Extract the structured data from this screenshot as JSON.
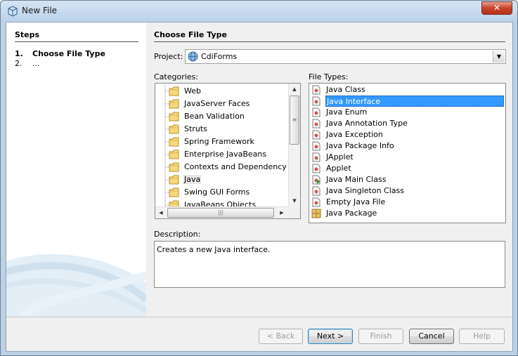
{
  "window": {
    "title": "New File",
    "close_glyph": "✕"
  },
  "steps": {
    "title": "Steps",
    "items": [
      {
        "num": "1.",
        "label": "Choose File Type"
      },
      {
        "num": "2.",
        "label": "..."
      }
    ]
  },
  "main": {
    "title": "Choose File Type",
    "project_label": "Project:",
    "project_value": "CdiForms",
    "categories_label": "Categories:",
    "file_types_label": "File Types:",
    "description_label": "Description:",
    "description_text": "Creates a new Java interface."
  },
  "categories": [
    "Web",
    "JavaServer Faces",
    "Bean Validation",
    "Struts",
    "Spring Framework",
    "Enterprise JavaBeans",
    "Contexts and Dependency Injection",
    "Java",
    "Swing GUI Forms",
    "JavaBeans Objects"
  ],
  "selected_category": "Java",
  "file_types": [
    {
      "label": "Java Class",
      "icon": "java-class-icon"
    },
    {
      "label": "Java Interface",
      "icon": "java-interface-icon"
    },
    {
      "label": "Java Enum",
      "icon": "java-enum-icon"
    },
    {
      "label": "Java Annotation Type",
      "icon": "java-annotation-icon"
    },
    {
      "label": "Java Exception",
      "icon": "java-exception-icon"
    },
    {
      "label": "Java Package Info",
      "icon": "java-package-info-icon"
    },
    {
      "label": "JApplet",
      "icon": "japplet-icon"
    },
    {
      "label": "Applet",
      "icon": "applet-icon"
    },
    {
      "label": "Java Main Class",
      "icon": "java-main-class-icon"
    },
    {
      "label": "Java Singleton Class",
      "icon": "java-singleton-icon"
    },
    {
      "label": "Empty Java File",
      "icon": "empty-java-file-icon"
    },
    {
      "label": "Java Package",
      "icon": "java-package-icon"
    }
  ],
  "selected_file_type": "Java Interface",
  "buttons": {
    "back": "< Back",
    "next": "Next >",
    "finish": "Finish",
    "cancel": "Cancel",
    "help": "Help"
  },
  "colors": {
    "selection": "#3399ff",
    "title_bar": "#bcd2ea"
  }
}
